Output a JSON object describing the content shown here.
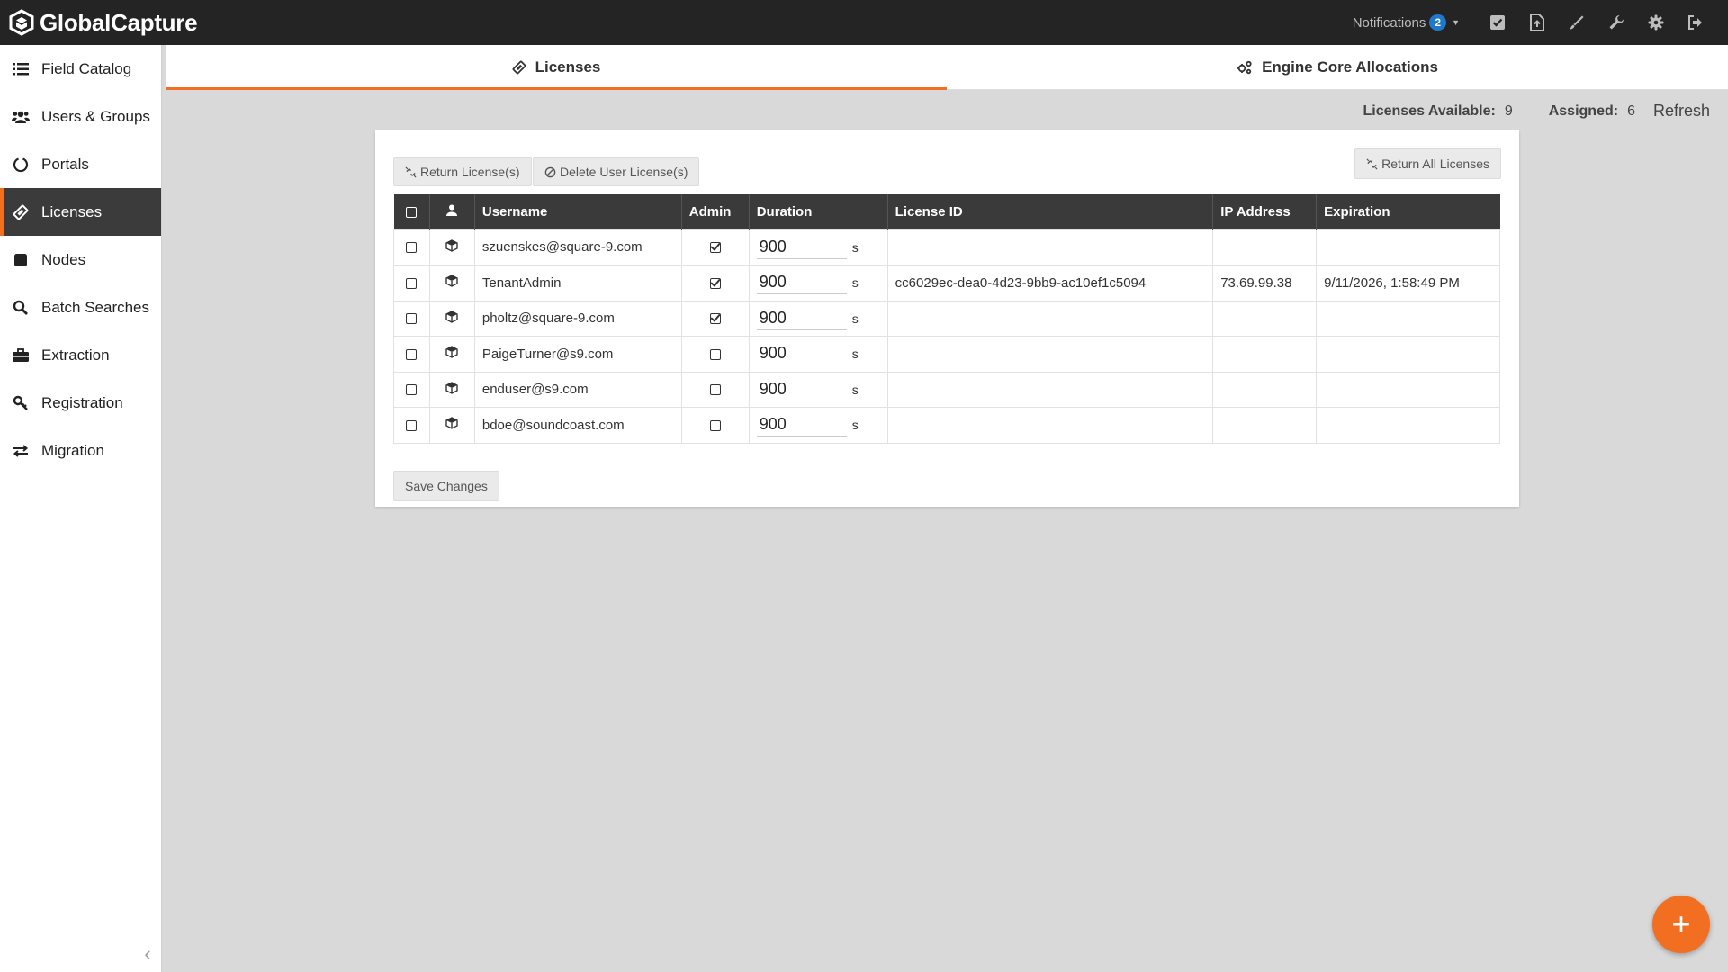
{
  "app": {
    "name": "GlobalCapture"
  },
  "topbar": {
    "notifications_label": "Notifications",
    "notifications_count": "2",
    "icons": [
      "tasks-icon",
      "document-upload-icon",
      "pen-icon",
      "wrench-icon",
      "gear-icon",
      "logout-icon"
    ]
  },
  "sidebar": {
    "items": [
      {
        "label": "Field Catalog",
        "icon": "list-icon"
      },
      {
        "label": "Users & Groups",
        "icon": "users-icon"
      },
      {
        "label": "Portals",
        "icon": "circle-notch-icon"
      },
      {
        "label": "Licenses",
        "icon": "ticket-icon",
        "active": true
      },
      {
        "label": "Nodes",
        "icon": "square-icon"
      },
      {
        "label": "Batch Searches",
        "icon": "search-icon"
      },
      {
        "label": "Extraction",
        "icon": "briefcase-icon"
      },
      {
        "label": "Registration",
        "icon": "key-icon"
      },
      {
        "label": "Migration",
        "icon": "exchange-icon"
      }
    ]
  },
  "tabs": [
    {
      "label": "Licenses",
      "active": true
    },
    {
      "label": "Engine Core Allocations",
      "active": false
    }
  ],
  "stats": {
    "available_label": "Licenses Available:",
    "available_value": "9",
    "assigned_label": "Assigned:",
    "assigned_value": "6",
    "refresh_label": "Refresh"
  },
  "actions": {
    "return_licenses": "Return License(s)",
    "delete_user_licenses": "Delete User License(s)",
    "return_all_licenses": "Return All Licenses",
    "save_changes": "Save Changes"
  },
  "table": {
    "columns": [
      "Username",
      "Admin",
      "Duration",
      "License ID",
      "IP Address",
      "Expiration"
    ],
    "duration_unit": "s",
    "rows": [
      {
        "username": "szuenskes@square-9.com",
        "admin": true,
        "duration": "900",
        "license_id": "",
        "ip": "",
        "expiration": ""
      },
      {
        "username": "TenantAdmin",
        "admin": true,
        "duration": "900",
        "license_id": "cc6029ec-dea0-4d23-9bb9-ac10ef1c5094",
        "ip": "73.69.99.38",
        "expiration": "9/11/2026, 1:58:49 PM"
      },
      {
        "username": "pholtz@square-9.com",
        "admin": true,
        "duration": "900",
        "license_id": "",
        "ip": "",
        "expiration": ""
      },
      {
        "username": "PaigeTurner@s9.com",
        "admin": false,
        "duration": "900",
        "license_id": "",
        "ip": "",
        "expiration": ""
      },
      {
        "username": "enduser@s9.com",
        "admin": false,
        "duration": "900",
        "license_id": "",
        "ip": "",
        "expiration": ""
      },
      {
        "username": "bdoe@soundcoast.com",
        "admin": false,
        "duration": "900",
        "license_id": "",
        "ip": "",
        "expiration": ""
      }
    ]
  },
  "colors": {
    "accent": "#f26f21",
    "topbar": "#242424",
    "badge": "#1f78c8"
  }
}
